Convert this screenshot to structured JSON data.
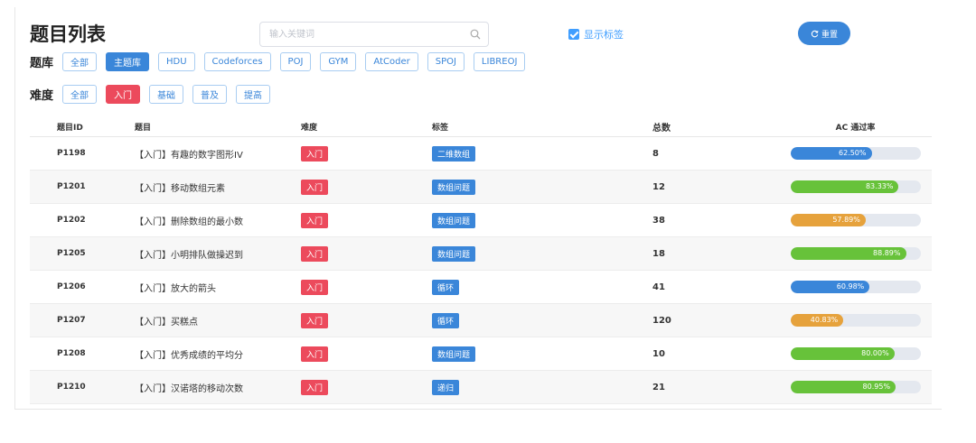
{
  "page": {
    "title": "题目列表"
  },
  "search": {
    "placeholder": "输入关键词",
    "value": ""
  },
  "show_tags": {
    "label": "显示标签",
    "checked": true
  },
  "reset": {
    "label": "重置"
  },
  "bank": {
    "label": "题库",
    "options": [
      {
        "label": "全部",
        "active": false
      },
      {
        "label": "主题库",
        "active": true
      },
      {
        "label": "HDU",
        "active": false
      },
      {
        "label": "Codeforces",
        "active": false
      },
      {
        "label": "POJ",
        "active": false
      },
      {
        "label": "GYM",
        "active": false
      },
      {
        "label": "AtCoder",
        "active": false
      },
      {
        "label": "SPOJ",
        "active": false
      },
      {
        "label": "LIBREOJ",
        "active": false
      }
    ]
  },
  "difficulty": {
    "label": "难度",
    "options": [
      {
        "label": "全部",
        "active": false
      },
      {
        "label": "入门",
        "active": true
      },
      {
        "label": "基础",
        "active": false
      },
      {
        "label": "普及",
        "active": false
      },
      {
        "label": "提高",
        "active": false
      }
    ]
  },
  "colors": {
    "blue": "#3a86d9",
    "green": "#67c23a",
    "orange": "#e6a23c",
    "red": "#ec4a5c"
  },
  "table": {
    "headers": {
      "id": "题目ID",
      "title": "题目",
      "difficulty": "难度",
      "tag": "标签",
      "total": "总数",
      "ac": "AC 通过率"
    },
    "rows": [
      {
        "id": "P1198",
        "title": "【入门】有趣的数字图形IV",
        "difficulty": "入门",
        "tag": "二维数组",
        "total": "8",
        "ac": "62.50%",
        "ac_value": 62.5,
        "ac_color": "blue"
      },
      {
        "id": "P1201",
        "title": "【入门】移动数组元素",
        "difficulty": "入门",
        "tag": "数组问题",
        "total": "12",
        "ac": "83.33%",
        "ac_value": 83.33,
        "ac_color": "green"
      },
      {
        "id": "P1202",
        "title": "【入门】删除数组的最小数",
        "difficulty": "入门",
        "tag": "数组问题",
        "total": "38",
        "ac": "57.89%",
        "ac_value": 57.89,
        "ac_color": "orange"
      },
      {
        "id": "P1205",
        "title": "【入门】小明排队做操迟到",
        "difficulty": "入门",
        "tag": "数组问题",
        "total": "18",
        "ac": "88.89%",
        "ac_value": 88.89,
        "ac_color": "green"
      },
      {
        "id": "P1206",
        "title": "【入门】放大的箭头",
        "difficulty": "入门",
        "tag": "循环",
        "total": "41",
        "ac": "60.98%",
        "ac_value": 60.98,
        "ac_color": "blue"
      },
      {
        "id": "P1207",
        "title": "【入门】买糕点",
        "difficulty": "入门",
        "tag": "循环",
        "total": "120",
        "ac": "40.83%",
        "ac_value": 40.83,
        "ac_color": "orange"
      },
      {
        "id": "P1208",
        "title": "【入门】优秀成绩的平均分",
        "difficulty": "入门",
        "tag": "数组问题",
        "total": "10",
        "ac": "80.00%",
        "ac_value": 80.0,
        "ac_color": "green"
      },
      {
        "id": "P1210",
        "title": "【入门】汉诺塔的移动次数",
        "difficulty": "入门",
        "tag": "递归",
        "total": "21",
        "ac": "80.95%",
        "ac_value": 80.95,
        "ac_color": "green"
      }
    ]
  }
}
